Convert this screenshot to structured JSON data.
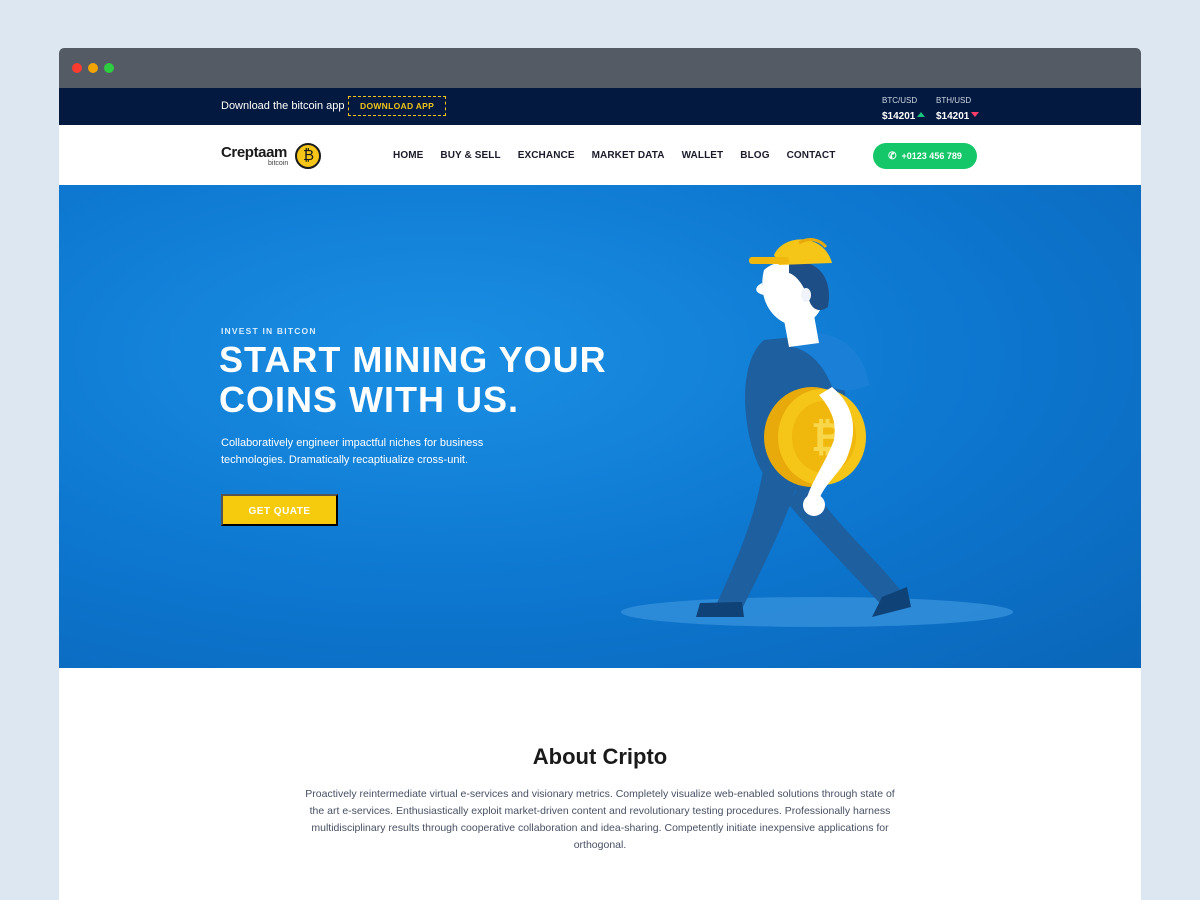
{
  "topbar": {
    "promo_text": "Download the bitcoin app",
    "download_label": "DOWNLOAD APP",
    "tickers": [
      {
        "pair": "BTC/USD",
        "price": "$14201",
        "trend": "up",
        "trend_color": "#19c37d"
      },
      {
        "pair": "BTH/USD",
        "price": "$14201",
        "trend": "down",
        "trend_color": "#ff3d6a"
      }
    ]
  },
  "nav": {
    "logo_word": "Creptaam",
    "logo_sub": "bitcoin",
    "items": [
      "HOME",
      "BUY & SELL",
      "EXCHANCE",
      "MARKET DATA",
      "WALLET",
      "BLOG",
      "CONTACT"
    ],
    "phone": "+0123 456 789",
    "phone_icon": "phone-icon"
  },
  "hero": {
    "eyebrow": "INVEST IN BITCON",
    "headline_line1": "START MINING YOUR",
    "headline_line2": "COINS WITH US.",
    "description": "Collaboratively engineer impactful niches for business technologies. Dramatically recaptiualize cross-unit.",
    "cta_label": "GET QUATE"
  },
  "about": {
    "title": "About Cripto",
    "body": "Proactively reintermediate virtual e-services and visionary metrics. Completely visualize web-enabled solutions through state of the art e-services. Enthusiastically exploit market-driven content and revolutionary testing procedures. Professionally harness multidisciplinary results through cooperative collaboration and idea-sharing. Competently initiate inexpensive applications for orthogonal."
  },
  "colors": {
    "brand_blue": "#0d76cf",
    "accent_yellow": "#f7cb0d",
    "topbar_navy": "#04193f",
    "phone_green": "#16c76a"
  }
}
